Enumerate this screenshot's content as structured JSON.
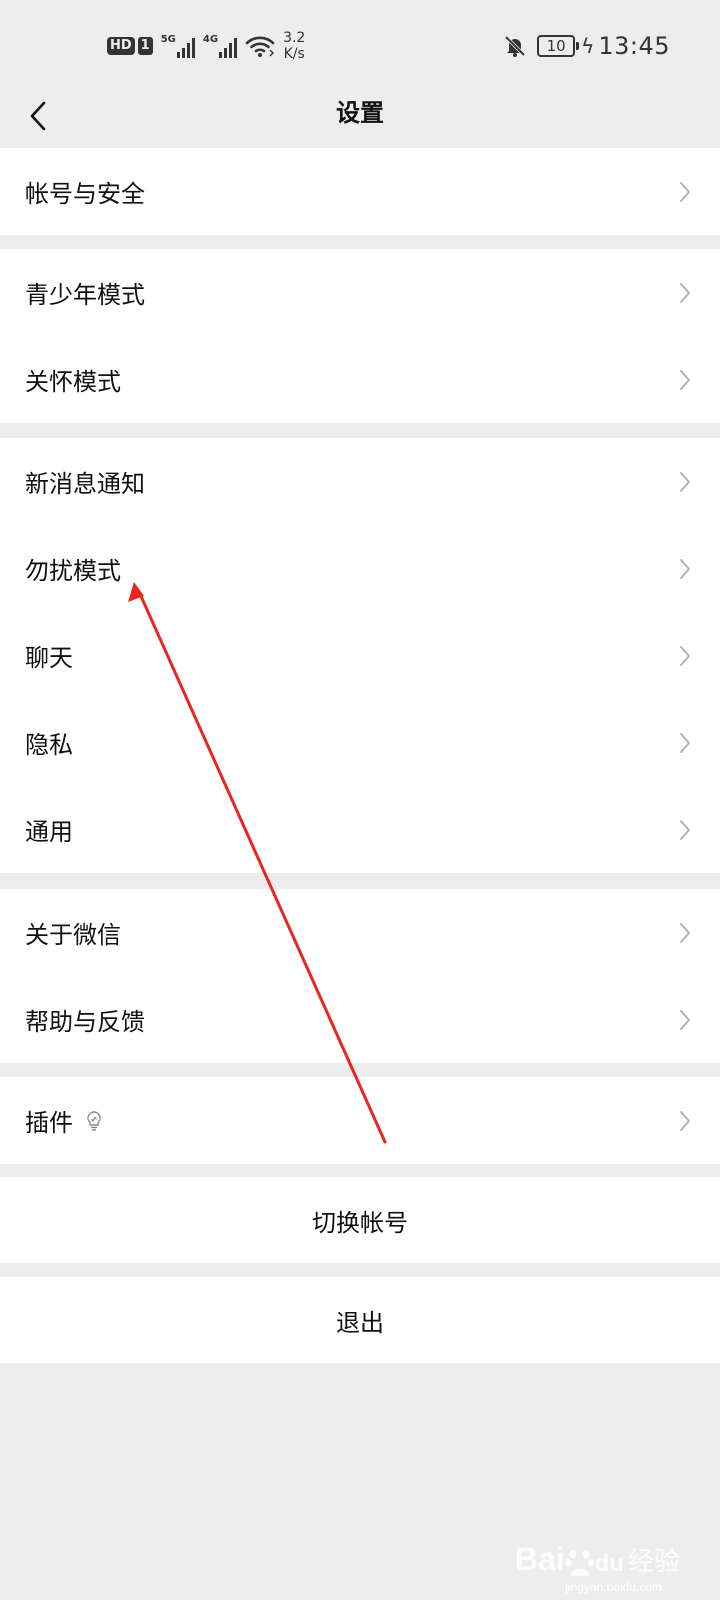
{
  "status_bar": {
    "hd": "HD",
    "sim": "1",
    "net1": "5G",
    "net2": "4G",
    "speed_value": "3.2",
    "speed_unit": "K/s",
    "battery": "10",
    "time": "13:45",
    "icons": [
      "signal-icon",
      "wifi-icon",
      "bell-off-icon",
      "battery-icon",
      "charging-icon"
    ]
  },
  "nav": {
    "title": "设置",
    "back_icon": "back-chevron-icon"
  },
  "groups": [
    {
      "items": [
        {
          "label": "帐号与安全"
        }
      ]
    },
    {
      "items": [
        {
          "label": "青少年模式"
        },
        {
          "label": "关怀模式"
        }
      ]
    },
    {
      "items": [
        {
          "label": "新消息通知"
        },
        {
          "label": "勿扰模式"
        },
        {
          "label": "聊天"
        },
        {
          "label": "隐私"
        },
        {
          "label": "通用"
        }
      ]
    },
    {
      "items": [
        {
          "label": "关于微信"
        },
        {
          "label": "帮助与反馈"
        }
      ]
    },
    {
      "items": [
        {
          "label": "插件",
          "icon": "lightbulb-icon"
        }
      ]
    }
  ],
  "actions": {
    "switch_account": "切换帐号",
    "logout": "退出"
  },
  "annotation": {
    "color": "#e8261e"
  },
  "watermark": {
    "logo": "Bai",
    "logo_paw": "du",
    "text": "经验",
    "url": "jingyan.baidu.com"
  },
  "colors": {
    "background": "#ededed",
    "cell": "#ffffff",
    "text": "#111111",
    "chevron": "#b2b2b2"
  }
}
